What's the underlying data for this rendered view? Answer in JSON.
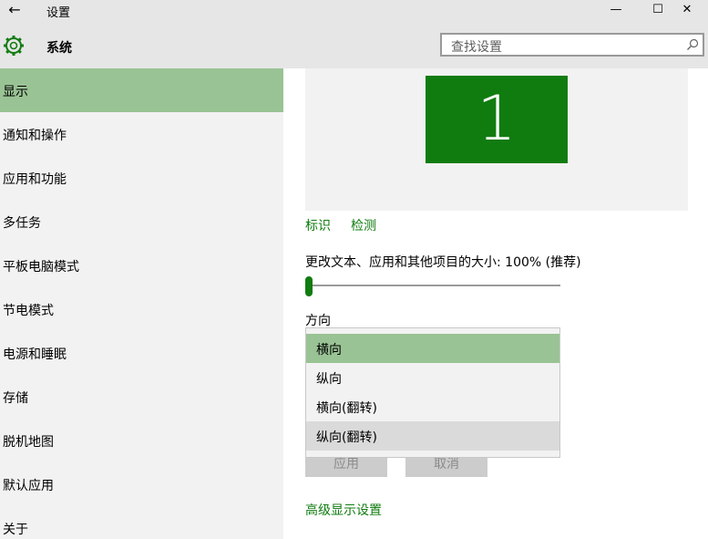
{
  "window": {
    "title": "设置",
    "back_icon": "←",
    "minimize_icon": "—",
    "maximize_icon": "☐",
    "close_icon": "✕"
  },
  "header": {
    "section_title": "系统",
    "search_placeholder": "查找设置"
  },
  "sidebar": {
    "items": [
      {
        "label": "显示",
        "selected": true
      },
      {
        "label": "通知和操作"
      },
      {
        "label": "应用和功能"
      },
      {
        "label": "多任务"
      },
      {
        "label": "平板电脑模式"
      },
      {
        "label": "节电模式"
      },
      {
        "label": "电源和睡眠"
      },
      {
        "label": "存储"
      },
      {
        "label": "脱机地图"
      },
      {
        "label": "默认应用"
      },
      {
        "label": "关于"
      }
    ]
  },
  "display": {
    "monitor_number": "1",
    "identify_link": "标识",
    "detect_link": "检测",
    "scale_label": "更改文本、应用和其他项目的大小: 100% (推荐)",
    "scale_slider_fraction": 0.0,
    "orientation_label": "方向",
    "orientation_options": [
      "横向",
      "纵向",
      "横向(翻转)",
      "纵向(翻转)"
    ],
    "orientation_selected": "横向",
    "apply_button": "应用",
    "cancel_button": "取消",
    "advanced_link": "高级显示设置"
  },
  "colors": {
    "accent": "#107c10",
    "selection": "#99c394",
    "sidebar_bg": "#f2f2f2",
    "titlebar_bg": "#e6e6e6"
  }
}
